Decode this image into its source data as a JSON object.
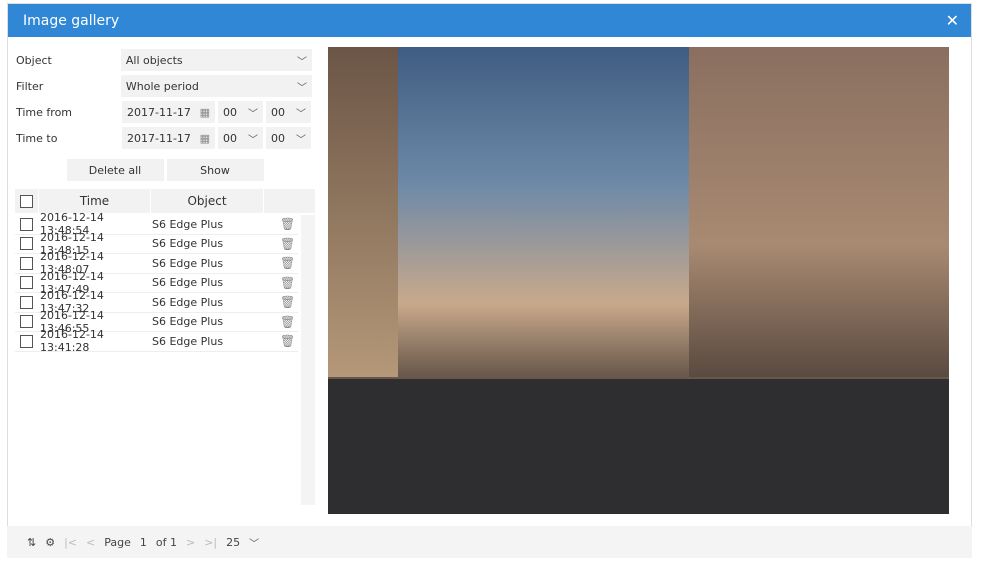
{
  "title": "Image gallery",
  "form": {
    "object_label": "Object",
    "object_value": "All objects",
    "filter_label": "Filter",
    "filter_value": "Whole period",
    "from_label": "Time from",
    "from_date": "2017-11-17",
    "from_hour": "00",
    "from_min": "00",
    "to_label": "Time to",
    "to_date": "2017-11-17",
    "to_hour": "00",
    "to_min": "00",
    "delete_all": "Delete all",
    "show": "Show"
  },
  "table": {
    "headers": [
      "Time",
      "Object"
    ],
    "rows": [
      {
        "time": "2016-12-14 13:48:54",
        "object": "S6 Edge Plus"
      },
      {
        "time": "2016-12-14 13:48:15",
        "object": "S6 Edge Plus"
      },
      {
        "time": "2016-12-14 13:48:07",
        "object": "S6 Edge Plus"
      },
      {
        "time": "2016-12-14 13:47:49",
        "object": "S6 Edge Plus"
      },
      {
        "time": "2016-12-14 13:47:32",
        "object": "S6 Edge Plus"
      },
      {
        "time": "2016-12-14 13:46:55",
        "object": "S6 Edge Plus"
      },
      {
        "time": "2016-12-14 13:41:28",
        "object": "S6 Edge Plus"
      }
    ]
  },
  "pager": {
    "page_label": "Page",
    "page": "1",
    "of": "of 1",
    "page_size": "25"
  }
}
